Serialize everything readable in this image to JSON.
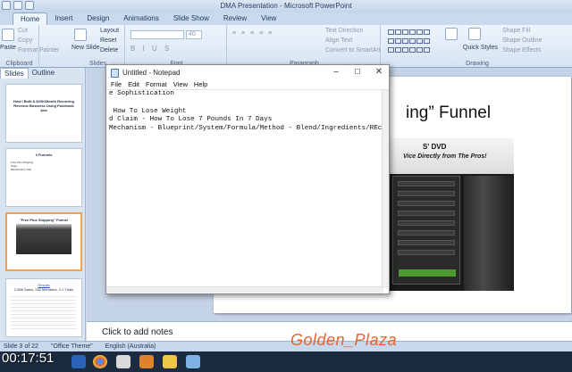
{
  "powerpoint": {
    "title": "DMA Presentation - Microsoft PowerPoint",
    "tabs": [
      "Home",
      "Insert",
      "Design",
      "Animations",
      "Slide Show",
      "Review",
      "View"
    ],
    "ribbon": {
      "clipboard": {
        "paste": "Paste",
        "cut": "Cut",
        "copy": "Copy",
        "format_painter": "Format Painter",
        "label": "Clipboard"
      },
      "slides": {
        "new_slide": "New Slide",
        "layout": "Layout",
        "reset": "Reset",
        "delete": "Delete",
        "label": "Slides"
      },
      "font": {
        "size": "40",
        "label": "Font"
      },
      "paragraph": {
        "text_direction": "Text Direction",
        "align_text": "Align Text",
        "convert_smartart": "Convert to SmartArt",
        "label": "Paragraph"
      },
      "drawing": {
        "quick_styles": "Quick Styles",
        "shape_fill": "Shape Fill",
        "shape_outline": "Shape Outline",
        "shape_effects": "Shape Effects",
        "label": "Drawing"
      }
    },
    "pane_tabs": [
      "Slides",
      "Outline"
    ],
    "thumbnails": [
      {
        "num": "",
        "title": "How I Built A $20K/Month Recurring Revenue Business Using Facebook Ads",
        "sub": ""
      },
      {
        "num": "",
        "title": "3 Funnels",
        "bullets": [
          "Free Plus Shipping",
          "Store",
          "Membership Trial"
        ]
      },
      {
        "num": "",
        "title": "\"Free Plus Shipping\" Funnel"
      },
      {
        "num": "",
        "title": "Results",
        "sub": "2,898 Sales, 246 Members, 1:1 Trials"
      }
    ],
    "slide": {
      "title_visible": "ing” Funnel",
      "dvd_text": "S' DVD",
      "promo_text": "Vice Directly from The Pros!"
    },
    "notes_placeholder": "Click to add notes",
    "status": {
      "slide": "Slide 3 of 22",
      "theme": "\"Office Theme\"",
      "language": "English (Australia)"
    }
  },
  "notepad": {
    "title": "Untitled - Notepad",
    "menu": [
      "File",
      "Edit",
      "Format",
      "View",
      "Help"
    ],
    "lines": [
      "e Sophistication",
      "",
      " How To Lose Weight",
      "d Claim - How To Lose 7 Pounds In 7 Days",
      "Mechanism - Blueprint/System/Formula/Method - Blend/Ingredients/REcipr"
    ]
  },
  "overlay": {
    "watermark": "Golden_Plaza",
    "timestamp": "00:17:51"
  },
  "colors": {
    "accent": "#f2a34a",
    "watermark": "#e8632e",
    "cta_green": "#4a9a2e"
  }
}
